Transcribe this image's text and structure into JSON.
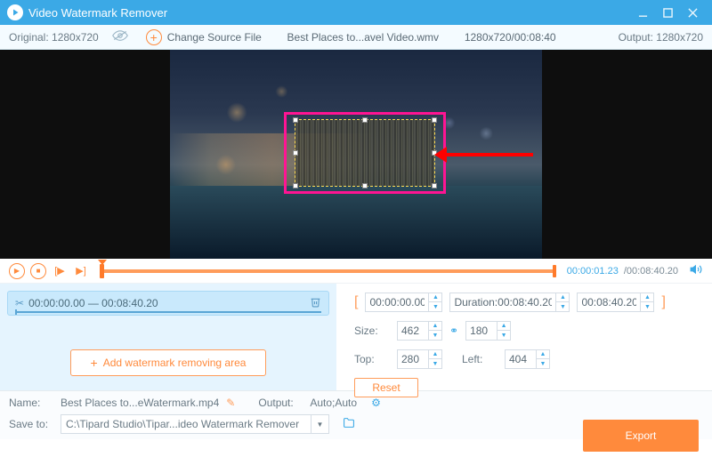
{
  "titlebar": {
    "title": "Video Watermark Remover"
  },
  "infobar": {
    "original": "Original: 1280x720",
    "change": "Change Source File",
    "filename": "Best Places to...avel Video.wmv",
    "diminfo": "1280x720/00:08:40",
    "output": "Output: 1280x720"
  },
  "controls": {
    "current": "00:00:01.23",
    "total": "/00:08:40.20"
  },
  "segment": {
    "start": "00:00:00.00",
    "dash": "—",
    "end": "00:08:40.20",
    "add": "Add watermark removing area"
  },
  "timerange": {
    "left_bracket": "[",
    "start": "00:00:00.00",
    "duration_label": "Duration:",
    "duration": "00:08:40.20",
    "end": "00:08:40.20",
    "right_bracket": "]"
  },
  "size": {
    "label": "Size:",
    "w": "462",
    "h": "180"
  },
  "pos": {
    "top_label": "Top:",
    "top": "280",
    "left_label": "Left:",
    "left": "404"
  },
  "reset": "Reset",
  "bottom": {
    "name_label": "Name:",
    "name": "Best Places to...eWatermark.mp4",
    "output_label": "Output:",
    "output": "Auto;Auto",
    "saveto_label": "Save to:",
    "saveto": "C:\\Tipard Studio\\Tipar...ideo Watermark Remover"
  },
  "export": "Export"
}
